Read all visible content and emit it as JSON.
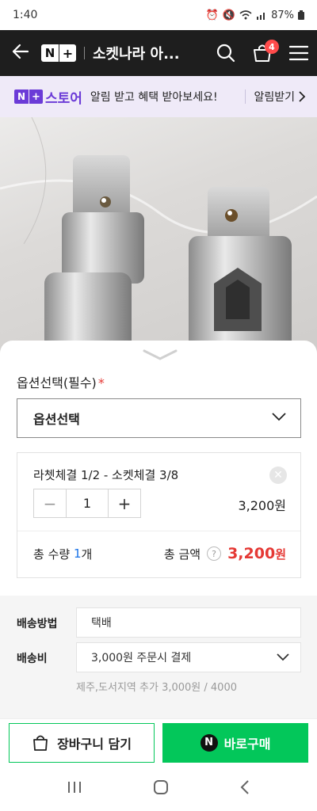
{
  "status_bar": {
    "time": "1:40",
    "battery": "87%"
  },
  "app_bar": {
    "title": "소켓나라 아...",
    "cart_count": "4",
    "logo_n": "N",
    "logo_plus": "+"
  },
  "promo": {
    "brand": "스토어",
    "message": "알림 받고 혜택 받아보세요!",
    "action": "알림받기"
  },
  "sheet": {
    "option_label": "옵션선택(필수)",
    "required_mark": "*",
    "select_placeholder": "옵션선택",
    "selected_item": {
      "name": "라쳇체결 1/2 - 소켓체결 3/8",
      "quantity": "1",
      "price": "3,200원"
    },
    "total": {
      "qty_prefix": "총 수량",
      "qty_value": "1",
      "qty_suffix": "개",
      "amount_label": "총 금액",
      "help": "?",
      "amount": "3,200",
      "currency": "원"
    }
  },
  "shipping": {
    "method_label": "배송방법",
    "method_value": "택배",
    "fee_label": "배송비",
    "fee_value": "3,000원 주문시 결제",
    "extra_note": "제주,도서지역 추가 3,000원 / 4000"
  },
  "actions": {
    "cart_label": "장바구니 담기",
    "buy_label": "바로구매",
    "buy_badge": "N"
  },
  "colors": {
    "naver_green": "#03c75a",
    "price_red": "#e53935",
    "promo_purple": "#6b3bd7",
    "appbar": "#1e1e1e"
  }
}
